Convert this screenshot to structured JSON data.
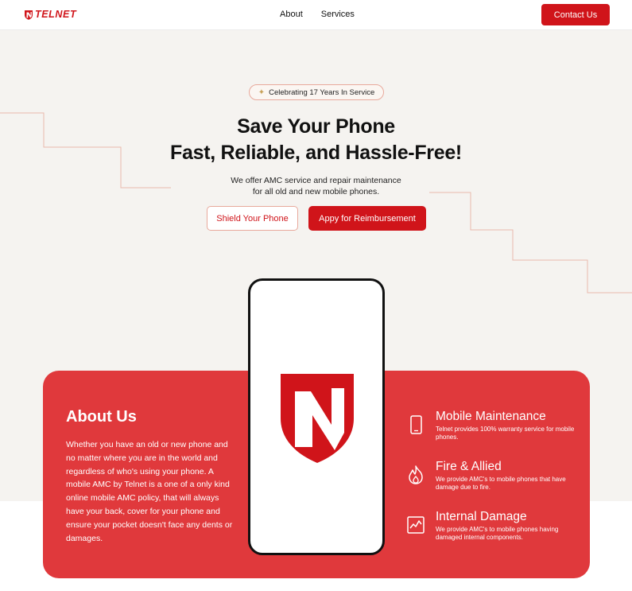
{
  "brand": {
    "name": "TELNET",
    "color": "#d0141a",
    "logo_icon": "telnet-shield-logo"
  },
  "nav": {
    "items": [
      {
        "label": "About"
      },
      {
        "label": "Services"
      }
    ],
    "contact_label": "Contact Us"
  },
  "hero": {
    "badge": {
      "icon": "wheat-sparkle-icon",
      "text": "Celebrating 17 Years In Service"
    },
    "title_line1": "Save Your Phone",
    "title_line2": "Fast, Reliable, and Hassle-Free!",
    "subtitle_line1": "We offer AMC service and repair maintenance",
    "subtitle_line2": "for all old and new mobile phones.",
    "primary_cta": "Appy for Reimbursement",
    "secondary_cta": "Shield Your Phone"
  },
  "about": {
    "title": "About Us",
    "text": "Whether you have an old or new phone and no matter where you are in the world and regardless of who's using your phone. A mobile AMC by Telnet is a one of a only kind online mobile AMC policy, that will always have your back, cover for your phone and ensure your pocket doesn't face any dents or damages.",
    "card_color": "#e0393c"
  },
  "features": [
    {
      "icon": "mobile-phone-icon",
      "title": "Mobile Maintenance",
      "description": "Telnet provides 100% warranty service for mobile phones."
    },
    {
      "icon": "fire-icon",
      "title": "Fire & Allied",
      "description": "We provide AMC's to mobile phones that have damage due to fire."
    },
    {
      "icon": "chart-damage-icon",
      "title": "Internal Damage",
      "description": "We provide AMC's to mobile phones having damaged internal components."
    }
  ]
}
